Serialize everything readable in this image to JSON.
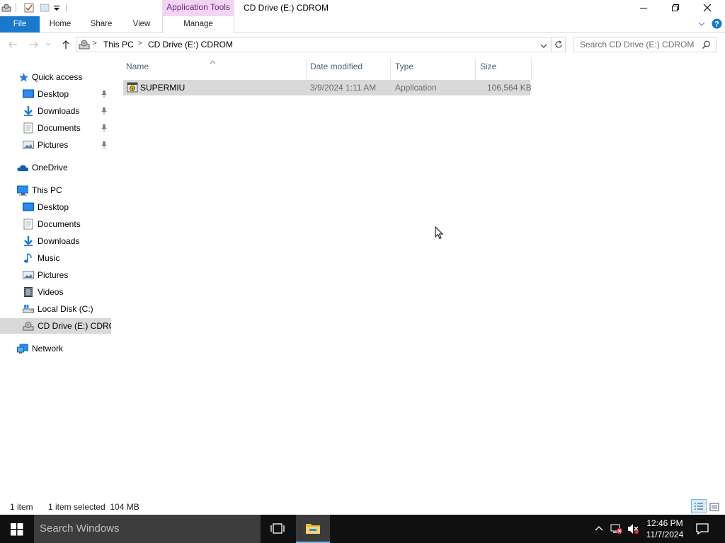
{
  "window": {
    "title": "CD Drive (E:) CDROM",
    "contextual_tab_group": "Application Tools"
  },
  "ribbon": {
    "tabs": [
      {
        "label": "File"
      },
      {
        "label": "Home"
      },
      {
        "label": "Share"
      },
      {
        "label": "View"
      },
      {
        "label": "Manage"
      }
    ]
  },
  "address": {
    "crumbs": [
      "This PC",
      "CD Drive (E:) CDROM"
    ],
    "search_placeholder": "Search CD Drive (E:) CDROM"
  },
  "navpane": {
    "quick_access": {
      "label": "Quick access",
      "items": [
        {
          "label": "Desktop",
          "icon": "desktop-icon",
          "pinned": true
        },
        {
          "label": "Downloads",
          "icon": "downloads-icon",
          "pinned": true
        },
        {
          "label": "Documents",
          "icon": "documents-icon",
          "pinned": true
        },
        {
          "label": "Pictures",
          "icon": "pictures-icon",
          "pinned": true
        }
      ]
    },
    "onedrive": {
      "label": "OneDrive"
    },
    "this_pc": {
      "label": "This PC",
      "items": [
        {
          "label": "Desktop",
          "icon": "desktop-icon"
        },
        {
          "label": "Documents",
          "icon": "documents-icon"
        },
        {
          "label": "Downloads",
          "icon": "downloads-icon"
        },
        {
          "label": "Music",
          "icon": "music-icon"
        },
        {
          "label": "Pictures",
          "icon": "pictures-icon"
        },
        {
          "label": "Videos",
          "icon": "videos-icon"
        },
        {
          "label": "Local Disk (C:)",
          "icon": "local-disk-icon"
        },
        {
          "label": "CD Drive (E:) CDROM",
          "icon": "cd-drive-icon",
          "selected": true
        }
      ]
    },
    "network": {
      "label": "Network"
    }
  },
  "columns": [
    "Name",
    "Date modified",
    "Type",
    "Size"
  ],
  "files": [
    {
      "name": "SUPERMIU",
      "date_modified": "3/9/2024 1:11 AM",
      "type": "Application",
      "size": "106,564 KB",
      "selected": true
    }
  ],
  "status": {
    "count": "1 item",
    "selection": "1 item selected  104 MB"
  },
  "taskbar": {
    "search_placeholder": "Search Windows",
    "time": "12:46 PM",
    "date": "11/7/2024"
  },
  "colors": {
    "accent": "#1979ca",
    "contextual": "#f2d5f3",
    "selection": "#d9d9d9",
    "taskbar": "#101010"
  }
}
